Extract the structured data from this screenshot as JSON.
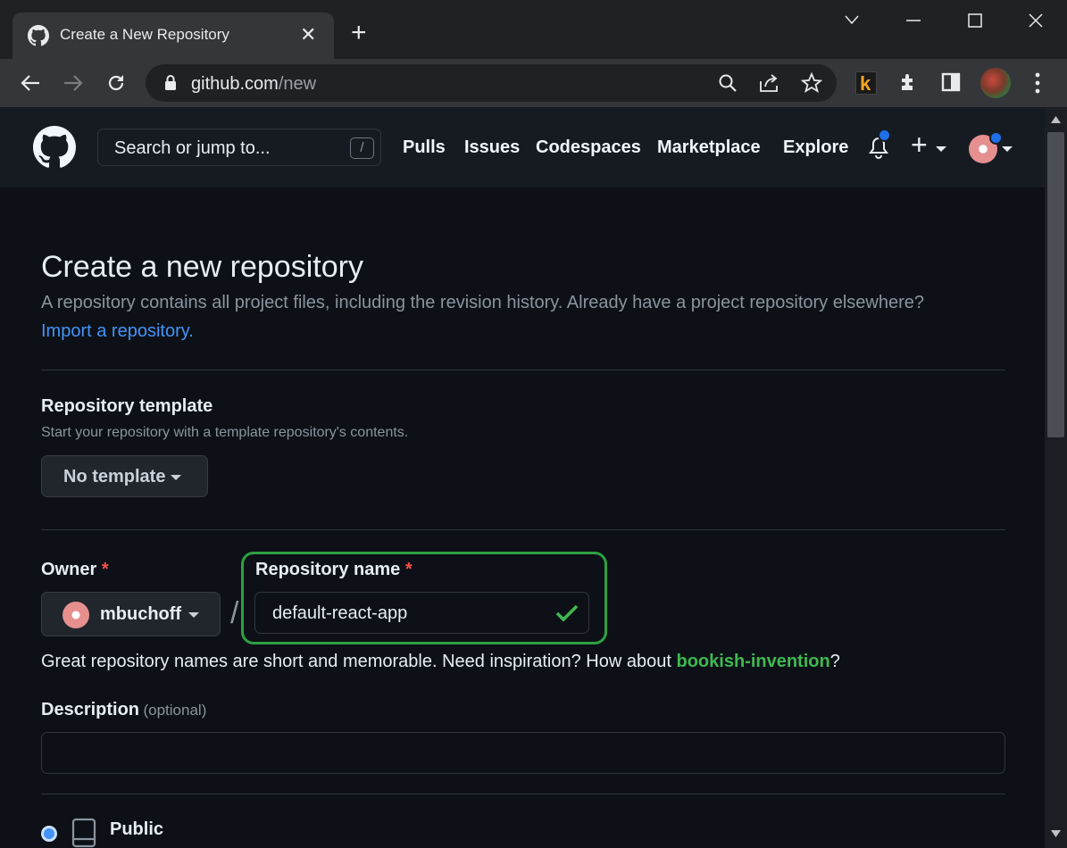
{
  "browser": {
    "tab_title": "Create a New Repository",
    "tab_close": "✕",
    "new_tab": "+",
    "url_host": "github.com",
    "url_path": "/new",
    "ext_label": "k"
  },
  "header": {
    "search_placeholder": "Search or jump to...",
    "search_shortcut": "/",
    "nav": [
      "Pulls",
      "Issues",
      "Codespaces",
      "Marketplace",
      "Explore"
    ],
    "plus": "+"
  },
  "page": {
    "title": "Create a new repository",
    "subtitle": "A repository contains all project files, including the revision history. Already have a project repository elsewhere?",
    "import_link": "Import a repository.",
    "template_label": "Repository template",
    "template_hint": "Start your repository with a template repository's contents.",
    "template_button": "No template",
    "owner_label": "Owner",
    "required_mark": "*",
    "owner_value": "mbuchoff",
    "separator": "/",
    "repo_name_label": "Repository name",
    "repo_name_value": "default-react-app",
    "hint_prefix": "Great repository names are short and memorable. Need inspiration? How about ",
    "hint_suggestion": "bookish-invention",
    "hint_suffix": "?",
    "description_label": "Description",
    "description_optional": "(optional)",
    "description_value": "",
    "visibility_public": "Public"
  },
  "colors": {
    "accent_green": "#3fb950",
    "highlight_box": "#2ea043",
    "link_blue": "#4493f8",
    "notification_blue": "#1f6feb"
  }
}
